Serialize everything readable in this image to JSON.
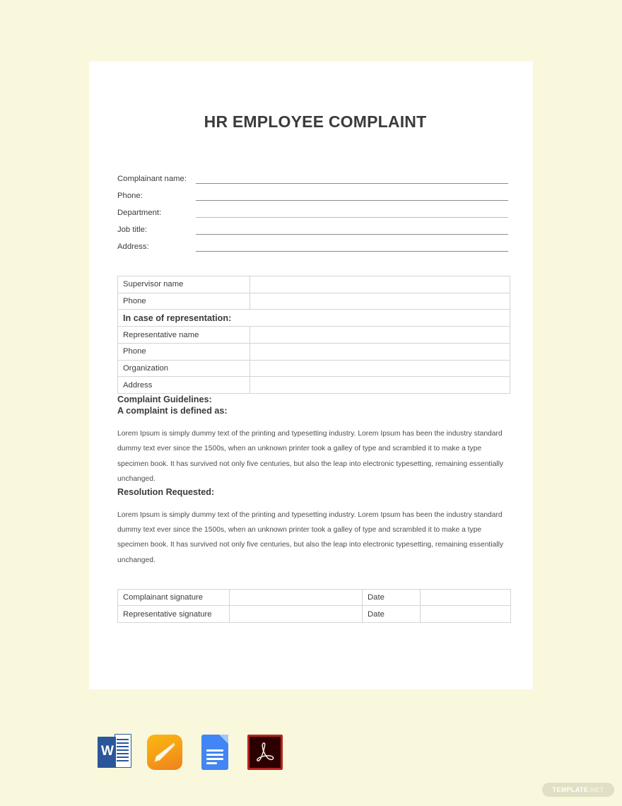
{
  "colors": {
    "page_background": "#f9f8dc",
    "sheet": "#ffffff",
    "heading_text": "#3b3b3b",
    "body_text": "#4d4d4d",
    "rule_line": "#8c8c8c",
    "table_border": "#d4d4d4",
    "word_blue": "#2b579a",
    "pages_orange": "#f6a114",
    "gdocs_blue": "#4285f4",
    "pdf_red": "#b5231f",
    "watermark_pill": "#e2e0c4"
  },
  "document": {
    "title": "HR EMPLOYEE COMPLAINT",
    "fields": [
      {
        "label": "Complainant name:",
        "value": ""
      },
      {
        "label": "Phone:",
        "value": ""
      },
      {
        "label": "Department:",
        "value": ""
      },
      {
        "label": "Job title:",
        "value": ""
      },
      {
        "label": "Address:",
        "value": ""
      }
    ],
    "info_table": {
      "rows": [
        {
          "type": "pair",
          "label": "Supervisor name",
          "value": ""
        },
        {
          "type": "pair",
          "label": "Phone",
          "value": ""
        },
        {
          "type": "section",
          "label": "In case of representation:"
        },
        {
          "type": "pair",
          "label": "Representative name",
          "value": ""
        },
        {
          "type": "pair",
          "label": "Phone",
          "value": ""
        },
        {
          "type": "pair",
          "label": "Organization",
          "value": ""
        },
        {
          "type": "pair",
          "label": "Address",
          "value": ""
        }
      ]
    },
    "guidelines_heading": "Complaint Guidelines:",
    "defined_heading": "A complaint is defined as:",
    "defined_body": "Lorem Ipsum is simply dummy text of the printing and typesetting industry. Lorem Ipsum has been the industry standard dummy text ever since the 1500s, when an unknown printer took a galley of type and scrambled it to make a type specimen book. It has survived not only five centuries, but also the leap into electronic typesetting, remaining essentially unchanged.",
    "resolution_heading": "Resolution Requested:",
    "resolution_body": "Lorem Ipsum is simply dummy text of the printing and typesetting industry. Lorem Ipsum has been the industry standard dummy text ever since the 1500s, when an unknown printer took a galley of type and scrambled it to make a type specimen book. It has survived not only five centuries, but also the leap into electronic typesetting, remaining essentially unchanged.",
    "signature_table": {
      "rows": [
        {
          "signature_label": "Complainant signature",
          "signature_value": "",
          "date_label": "Date",
          "date_value": ""
        },
        {
          "signature_label": "Representative signature",
          "signature_value": "",
          "date_label": "Date",
          "date_value": ""
        }
      ]
    }
  },
  "formats": [
    {
      "name": "microsoft-word-icon",
      "label": "W"
    },
    {
      "name": "apple-pages-icon",
      "label": ""
    },
    {
      "name": "google-docs-icon",
      "label": ""
    },
    {
      "name": "adobe-pdf-icon",
      "label": ""
    }
  ],
  "watermark": {
    "primary": "TEMPLATE",
    "secondary": ".NET"
  }
}
